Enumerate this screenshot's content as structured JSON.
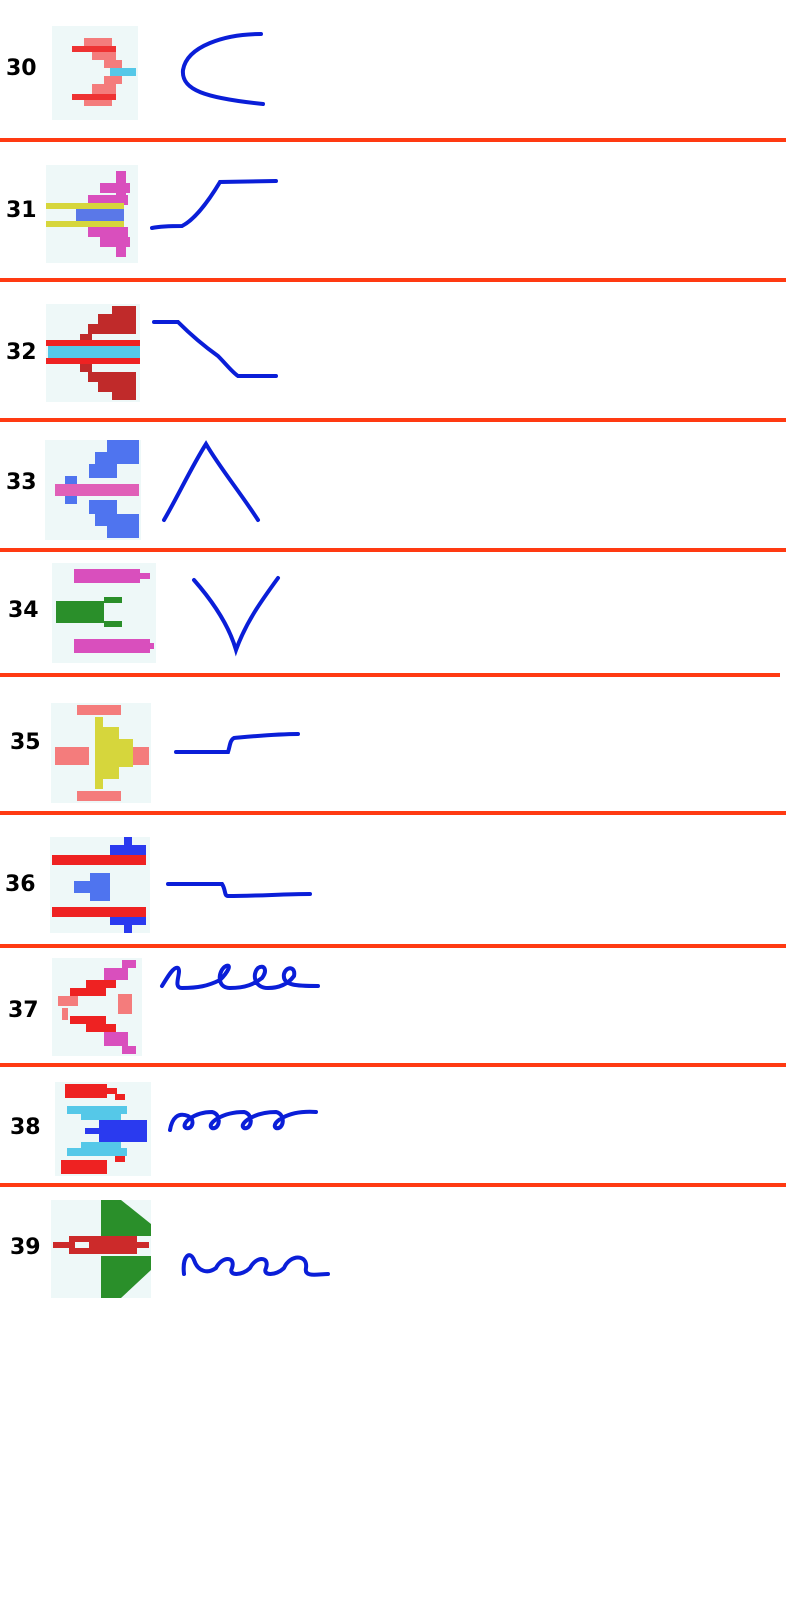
{
  "enemies": [
    {
      "number": "30",
      "sprite_icon": "red-claw-ship-icon",
      "path_icon": "c-curve-path-icon"
    },
    {
      "number": "31",
      "sprite_icon": "magenta-winged-ship-icon",
      "path_icon": "step-rise-path-icon"
    },
    {
      "number": "32",
      "sprite_icon": "darkred-checkered-ship-icon",
      "path_icon": "step-drop-path-icon"
    },
    {
      "number": "33",
      "sprite_icon": "blue-e-shape-ship-icon",
      "path_icon": "caret-up-path-icon"
    },
    {
      "number": "34",
      "sprite_icon": "green-pincer-ship-icon",
      "path_icon": "vee-path-icon"
    },
    {
      "number": "35",
      "sprite_icon": "yellow-triangle-ship-icon",
      "path_icon": "small-step-rise-path-icon"
    },
    {
      "number": "36",
      "sprite_icon": "blue-crab-ship-icon",
      "path_icon": "small-step-drop-path-icon"
    },
    {
      "number": "37",
      "sprite_icon": "red-magenta-bug-ship-icon",
      "path_icon": "loops-path-icon"
    },
    {
      "number": "38",
      "sprite_icon": "red-cyan-claw-ship-icon",
      "path_icon": "coils-path-icon"
    },
    {
      "number": "39",
      "sprite_icon": "green-fin-ship-icon",
      "path_icon": "curls-path-icon"
    }
  ],
  "colors": {
    "separator": "#ff3a12",
    "path": "#0a1ed8",
    "sprite_bg": "#eef8f8"
  }
}
